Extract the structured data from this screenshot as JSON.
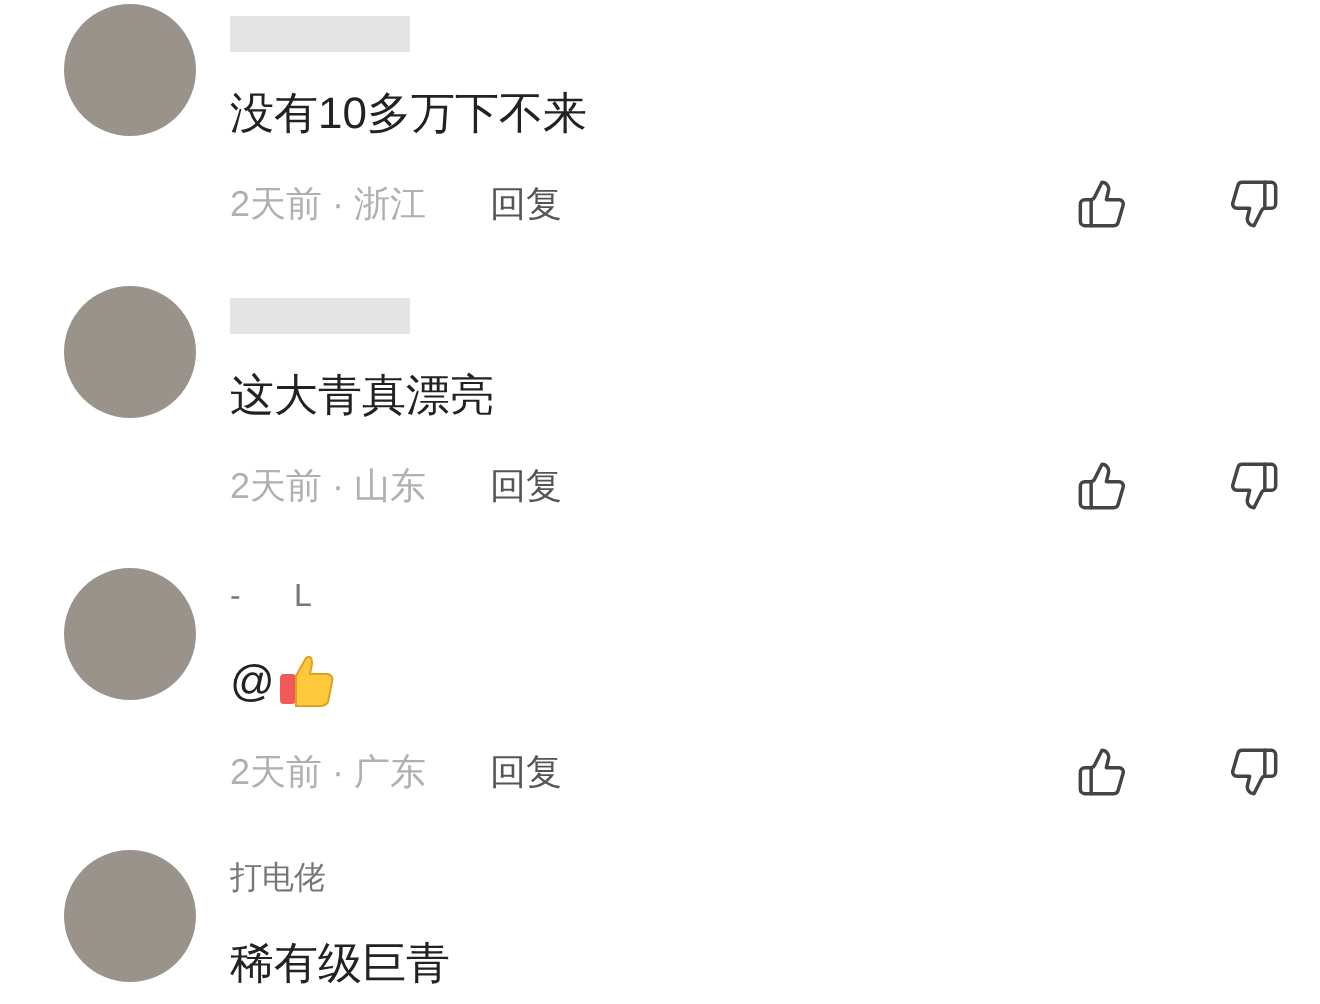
{
  "comments": [
    {
      "name_redacted": true,
      "text": "没有10多万下不来",
      "emoji": false,
      "meta": "2天前 · 浙江",
      "reply": "回复"
    },
    {
      "name_redacted": true,
      "text": "这大青真漂亮",
      "emoji": false,
      "meta": "2天前 · 山东",
      "reply": "回复"
    },
    {
      "name_redacted": false,
      "name": "-      L",
      "text": "@",
      "emoji": true,
      "meta": "2天前 · 广东",
      "reply": "回复"
    },
    {
      "name_redacted": false,
      "name": "打电佬",
      "text": "稀有级巨青",
      "emoji": false
    }
  ]
}
